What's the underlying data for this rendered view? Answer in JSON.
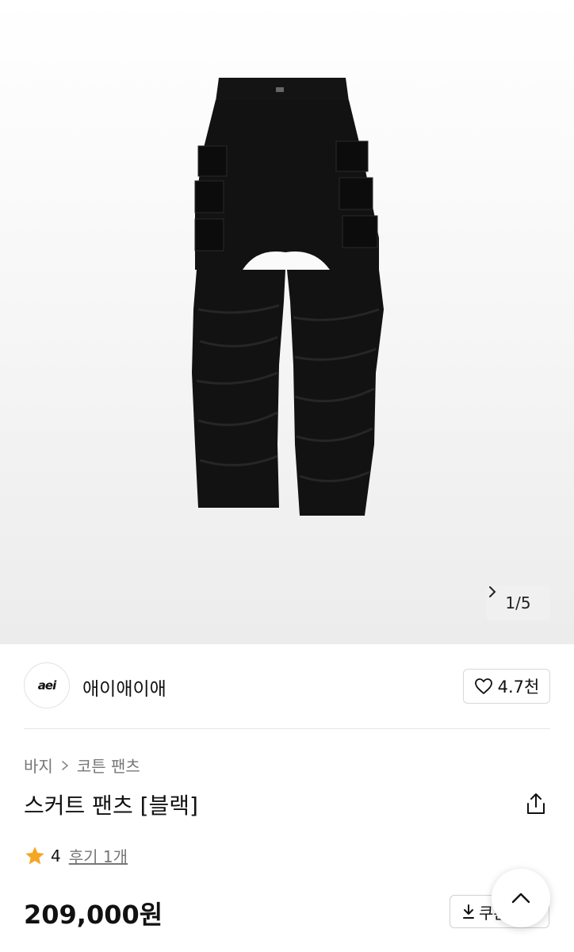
{
  "gallery": {
    "image_alt": "black cargo skirt pants",
    "counter": "1/5"
  },
  "brand": {
    "logo_text": "aei",
    "name": "애이애이애",
    "likes": "4.7천"
  },
  "breadcrumb": {
    "items": [
      "바지",
      "코튼 팬츠"
    ]
  },
  "product": {
    "title": "스커트 팬츠 [블랙]",
    "rating": "4",
    "reviews": "후기 1개",
    "price": "209,000원",
    "coupon_label": "쿠폰"
  },
  "colors": {
    "star": "#f5a623",
    "text_muted": "#777777"
  }
}
